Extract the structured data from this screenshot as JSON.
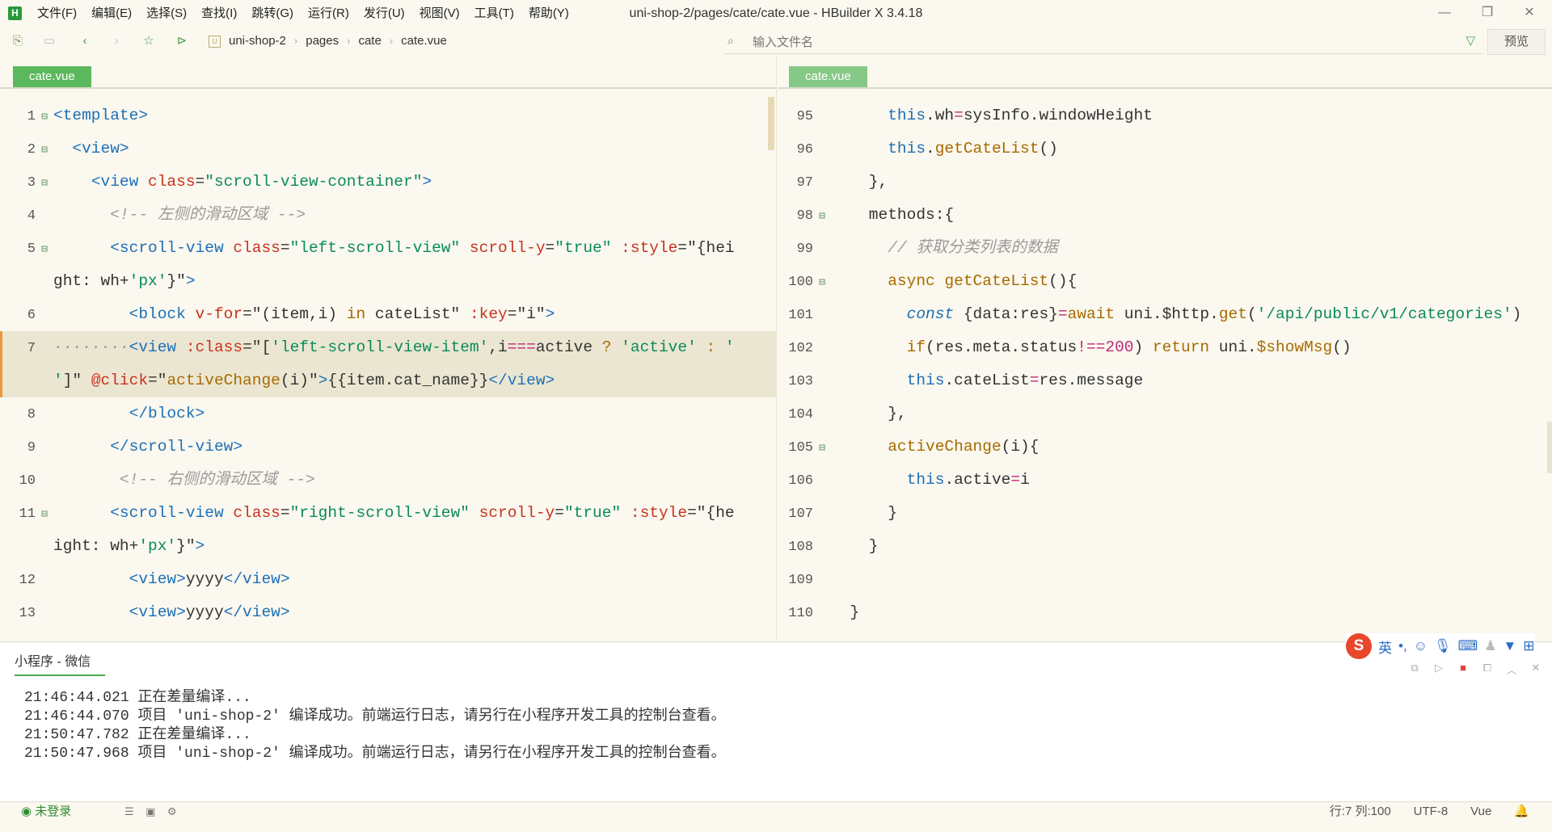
{
  "app": {
    "title": "uni-shop-2/pages/cate/cate.vue - HBuilder X 3.4.18",
    "logo": "H",
    "accent": "#2a9a3c"
  },
  "menu": [
    "文件(F)",
    "编辑(E)",
    "选择(S)",
    "查找(I)",
    "跳转(G)",
    "运行(R)",
    "发行(U)",
    "视图(V)",
    "工具(T)",
    "帮助(Y)"
  ],
  "window_controls": {
    "minimize": "—",
    "maximize": "❐",
    "close": "✕"
  },
  "breadcrumb": [
    "uni-shop-2",
    "pages",
    "cate",
    "cate.vue"
  ],
  "file_filter": {
    "placeholder": "输入文件名"
  },
  "preview_label": "预览",
  "left_editor": {
    "tab": "cate.vue",
    "lines": [
      {
        "n": "1",
        "fold": "⊟",
        "html": "<span class='k'>&lt;template&gt;</span>"
      },
      {
        "n": "2",
        "fold": "⊟",
        "html": "  <span class='k'>&lt;view&gt;</span>"
      },
      {
        "n": "3",
        "fold": "⊟",
        "html": "    <span class='k'>&lt;view</span> <span class='a'>class</span>=<span class='s'>\"scroll-view-container\"</span><span class='k'>&gt;</span>"
      },
      {
        "n": "4",
        "fold": "",
        "html": "      <span class='c'>&lt;!-- 左侧的滑动区域 --&gt;</span>"
      },
      {
        "n": "5",
        "fold": "⊟",
        "html": "      <span class='k'>&lt;scroll-view</span> <span class='a'>class</span>=<span class='s'>\"left-scroll-view\"</span> <span class='a'>scroll-y</span>=<span class='s'>\"true\"</span> <span class='a'>:style</span>=\"{hei"
      },
      {
        "n": "",
        "fold": "",
        "cont": true,
        "html": "ght: wh+<span class='s'>'px'</span>}\"<span class='k'>&gt;</span>"
      },
      {
        "n": "6",
        "fold": "",
        "html": "        <span class='k'>&lt;block</span> <span class='a'>v-for</span>=\"(item,i) <span class='f'>in</span> cateList\" <span class='a'>:key</span>=\"i\"<span class='k'>&gt;</span>"
      },
      {
        "n": "7",
        "fold": "",
        "hl": true,
        "html": "<span class='c'>········</span><span class='k'>&lt;view</span> <span class='a'>:class</span>=\"[<span class='s'>'left-scroll-view-item'</span>,i<span class='n'>===</span>active <span class='f'>?</span> <span class='s'>'active'</span> <span class='f'>:</span> <span class='s'>'</span>"
      },
      {
        "n": "",
        "fold": "",
        "cont": true,
        "hl": true,
        "html": "<span class='s'>'</span>]\" <span class='a'>@click</span>=\"<span class='f'>activeChange</span>(i)\"<span class='k'>&gt;</span>{{item.cat_name}}<span class='k'>&lt;/view&gt;</span>"
      },
      {
        "n": "8",
        "fold": "",
        "html": "        <span class='k'>&lt;/block&gt;</span>"
      },
      {
        "n": "9",
        "fold": "",
        "html": "      <span class='k'>&lt;/scroll-view&gt;</span>"
      },
      {
        "n": "10",
        "fold": "",
        "html": "       <span class='c'>&lt;!-- 右侧的滑动区域 --&gt;</span>"
      },
      {
        "n": "11",
        "fold": "⊟",
        "html": "      <span class='k'>&lt;scroll-view</span> <span class='a'>class</span>=<span class='s'>\"right-scroll-view\"</span> <span class='a'>scroll-y</span>=<span class='s'>\"true\"</span> <span class='a'>:style</span>=\"{he"
      },
      {
        "n": "",
        "fold": "",
        "cont": true,
        "html": "ight: wh+<span class='s'>'px'</span>}\"<span class='k'>&gt;</span>"
      },
      {
        "n": "12",
        "fold": "",
        "html": "        <span class='k'>&lt;view&gt;</span>yyyy<span class='k'>&lt;/view&gt;</span>"
      },
      {
        "n": "13",
        "fold": "",
        "html": "        <span class='k'>&lt;view&gt;</span>yyyy<span class='k'>&lt;/view&gt;</span>"
      }
    ]
  },
  "right_editor": {
    "tab": "cate.vue",
    "lines": [
      {
        "n": "95",
        "fold": "",
        "html": "      <span class='k'>this</span>.wh<span class='n'>=</span>sysInfo.windowHeight"
      },
      {
        "n": "96",
        "fold": "",
        "html": "      <span class='k'>this</span>.<span class='f'>getCateList</span>()"
      },
      {
        "n": "97",
        "fold": "",
        "html": "    },"
      },
      {
        "n": "98",
        "fold": "⊟",
        "html": "    methods:{"
      },
      {
        "n": "99",
        "fold": "",
        "html": "      <span class='c'>// 获取分类列表的数据</span>"
      },
      {
        "n": "100",
        "fold": "⊟",
        "html": "      <span class='f'>async</span> <span class='f'>getCateList</span>(){"
      },
      {
        "n": "101",
        "fold": "",
        "html": "        <span class='k' style='font-style:italic'>const</span> {data:res}<span class='n'>=</span><span class='f'>await</span> uni.$http.<span class='f'>get</span>(<span class='s'>'/api/public/v1/categories'</span>)"
      },
      {
        "n": "102",
        "fold": "",
        "html": "        <span class='f'>if</span>(res.meta.status<span class='n'>!==200</span>) <span class='f'>return</span> uni.<span class='f'>$showMsg</span>()"
      },
      {
        "n": "103",
        "fold": "",
        "html": "        <span class='k'>this</span>.cateList<span class='n'>=</span>res.message"
      },
      {
        "n": "104",
        "fold": "",
        "html": "      },"
      },
      {
        "n": "105",
        "fold": "⊟",
        "html": "      <span class='f'>activeChange</span>(i){"
      },
      {
        "n": "106",
        "fold": "",
        "html": "        <span class='k'>this</span>.active<span class='n'>=</span>i"
      },
      {
        "n": "107",
        "fold": "",
        "html": "      }"
      },
      {
        "n": "108",
        "fold": "",
        "html": "    }"
      },
      {
        "n": "109",
        "fold": "",
        "html": ""
      },
      {
        "n": "110",
        "fold": "",
        "html": "  }"
      }
    ]
  },
  "console": {
    "tab": "小程序 - 微信",
    "lines": [
      "21:46:44.021 正在差量编译...",
      "21:46:44.070 项目 'uni-shop-2' 编译成功。前端运行日志，请另行在小程序开发工具的控制台查看。",
      "21:50:47.782 正在差量编译...",
      "21:50:47.968 项目 'uni-shop-2' 编译成功。前端运行日志，请另行在小程序开发工具的控制台查看。"
    ]
  },
  "ime": {
    "logo": "S",
    "lang": "英"
  },
  "status": {
    "login": "未登录",
    "position": "行:7  列:100",
    "encoding": "UTF-8",
    "language": "Vue"
  }
}
